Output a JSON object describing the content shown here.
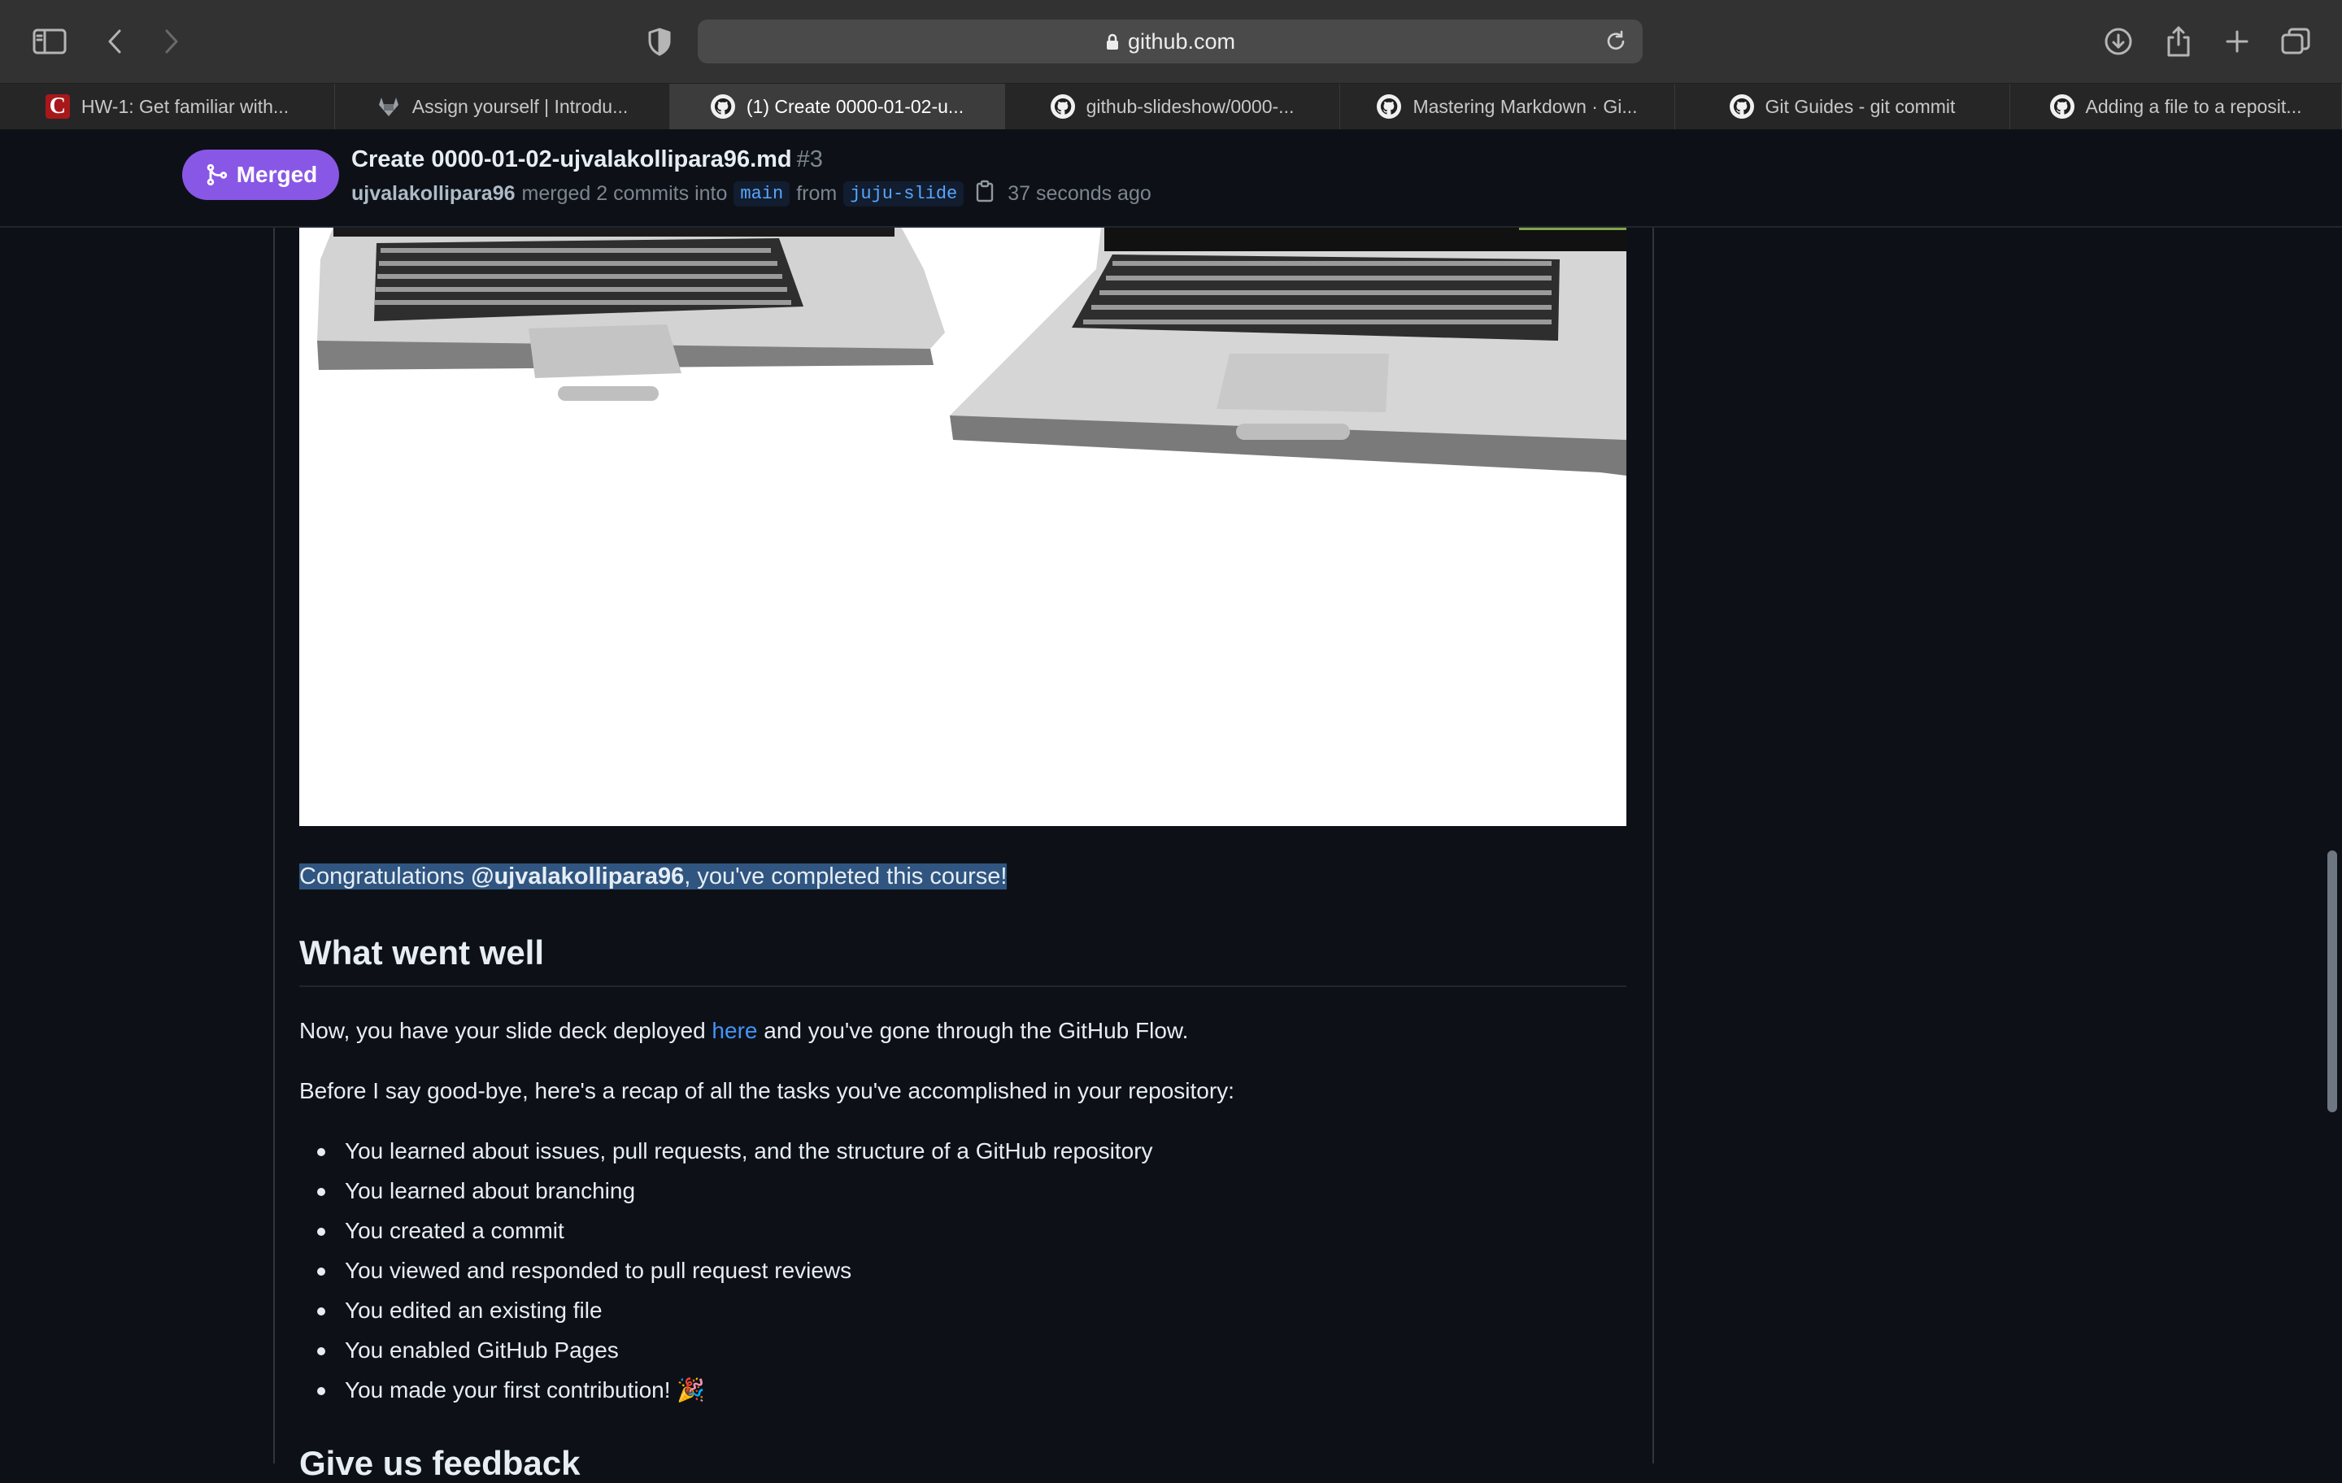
{
  "browser": {
    "url": "github.com",
    "icons": [
      "sidebar-icon",
      "back-icon",
      "forward-icon",
      "shield-icon",
      "lock-icon",
      "reload-icon",
      "download-icon",
      "share-icon",
      "new-tab-icon",
      "tab-overview-icon"
    ]
  },
  "tabs": [
    {
      "title": "HW-1: Get familiar with...",
      "favicon": "canvas"
    },
    {
      "title": "Assign yourself | Introdu...",
      "favicon": "gitlab"
    },
    {
      "title": "(1) Create 0000-01-02-u...",
      "favicon": "github",
      "active": true
    },
    {
      "title": "github-slideshow/0000-...",
      "favicon": "github"
    },
    {
      "title": "Mastering Markdown · Gi...",
      "favicon": "github"
    },
    {
      "title": "Git Guides - git commit",
      "favicon": "github"
    },
    {
      "title": "Adding a file to a reposit...",
      "favicon": "github"
    }
  ],
  "pr": {
    "state": "Merged",
    "title": "Create 0000-01-02-ujvalakollipara96.md",
    "number": "#3",
    "author": "ujvalakollipara96",
    "merge_text": "merged 2 commits into",
    "base_branch": "main",
    "from_text": "from",
    "head_branch": "juju-slide",
    "time": "37 seconds ago",
    "colors": {
      "merged": "#8957e5",
      "link": "#4493f8"
    }
  },
  "content": {
    "congrats_prefix": "Congratulations ",
    "congrats_user": "@ujvalakollipara96",
    "congrats_suffix": ", you've completed this course!",
    "heading_went_well": "What went well",
    "para1_before": "Now, you have your slide deck deployed ",
    "para1_link": "here",
    "para1_after": " and you've gone through the GitHub Flow.",
    "para2": "Before I say good-bye, here's a recap of all the tasks you've accomplished in your repository:",
    "tasks": [
      "You learned about issues, pull requests, and the structure of a GitHub repository",
      "You learned about branching",
      "You created a commit",
      "You viewed and responded to pull request reviews",
      "You edited an existing file",
      "You enabled GitHub Pages",
      "You made your first contribution! 🎉"
    ],
    "heading_feedback": "Give us feedback"
  }
}
